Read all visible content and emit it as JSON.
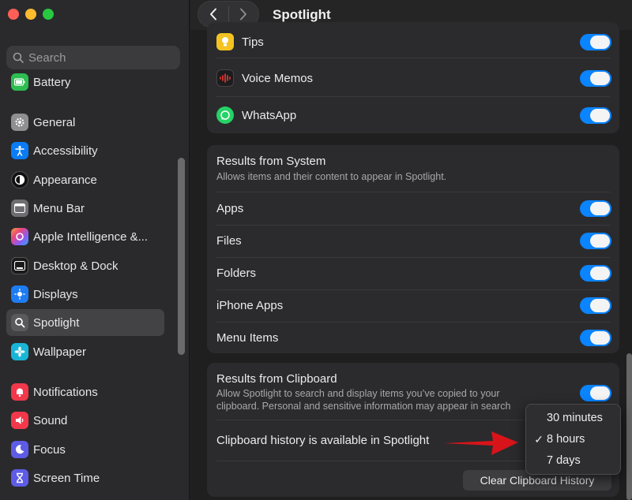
{
  "window": {
    "title": "Spotlight"
  },
  "sidebar": {
    "search_placeholder": "Search",
    "items": [
      {
        "label": "Battery",
        "icon": "battery-icon"
      },
      {
        "label": "General",
        "icon": "gear-icon"
      },
      {
        "label": "Accessibility",
        "icon": "accessibility-icon"
      },
      {
        "label": "Appearance",
        "icon": "appearance-icon"
      },
      {
        "label": "Menu Bar",
        "icon": "menu-bar-icon"
      },
      {
        "label": "Apple Intelligence &...",
        "icon": "apple-intelligence-icon"
      },
      {
        "label": "Desktop & Dock",
        "icon": "desktop-dock-icon"
      },
      {
        "label": "Displays",
        "icon": "displays-icon"
      },
      {
        "label": "Spotlight",
        "icon": "spotlight-icon",
        "selected": true
      },
      {
        "label": "Wallpaper",
        "icon": "wallpaper-icon"
      },
      {
        "label": "Notifications",
        "icon": "notifications-icon"
      },
      {
        "label": "Sound",
        "icon": "sound-icon"
      },
      {
        "label": "Focus",
        "icon": "focus-icon"
      },
      {
        "label": "Screen Time",
        "icon": "screen-time-icon"
      }
    ]
  },
  "apps": [
    {
      "label": "Tips",
      "on": true
    },
    {
      "label": "Voice Memos",
      "on": true
    },
    {
      "label": "WhatsApp",
      "on": true
    }
  ],
  "system": {
    "title": "Results from System",
    "description": "Allows items and their content to appear in Spotlight.",
    "items": [
      {
        "label": "Apps",
        "on": true
      },
      {
        "label": "Files",
        "on": true
      },
      {
        "label": "Folders",
        "on": true
      },
      {
        "label": "iPhone Apps",
        "on": true
      },
      {
        "label": "Menu Items",
        "on": true
      }
    ]
  },
  "clipboard": {
    "title": "Results from Clipboard",
    "description": "Allow Spotlight to search and display items you’ve copied to your clipboard. Personal and sensitive information may appear in search",
    "history_label": "Clipboard history is available in Spotlight",
    "clear_button": "Clear Clipboard History",
    "enabled": true
  },
  "dropdown": {
    "options": [
      "30 minutes",
      "8 hours",
      "7 days"
    ],
    "selected": "8 hours",
    "check": "✓"
  },
  "colors": {
    "accent": "#0a84ff",
    "annotation_arrow": "#d8141a"
  }
}
